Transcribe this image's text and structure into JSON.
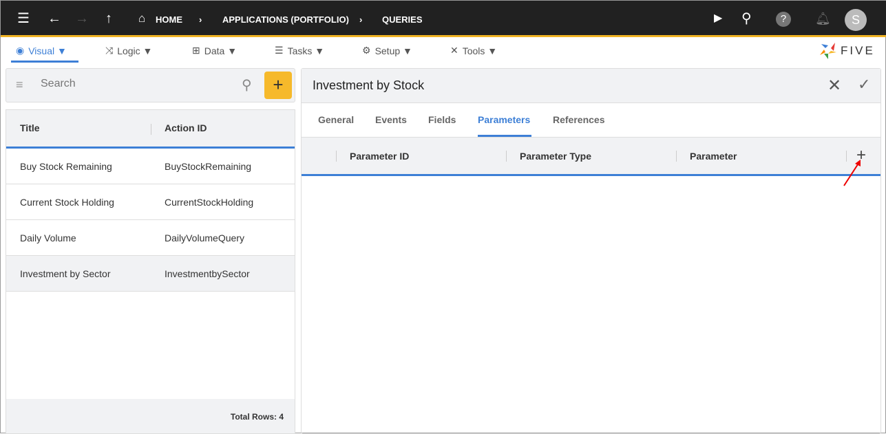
{
  "topbar": {
    "breadcrumbs": [
      "HOME",
      "APPLICATIONS (PORTFOLIO)",
      "QUERIES"
    ],
    "avatar": "S"
  },
  "menu": [
    {
      "label": "Visual ▼"
    },
    {
      "label": "Logic ▼"
    },
    {
      "label": "Data ▼"
    },
    {
      "label": "Tasks ▼"
    },
    {
      "label": "Setup ▼"
    },
    {
      "label": "Tools ▼"
    }
  ],
  "logo": "FIVE",
  "search": {
    "placeholder": "Search"
  },
  "list": {
    "columns": [
      "Title",
      "Action ID"
    ],
    "rows": [
      [
        "Buy Stock Remaining",
        "BuyStockRemaining"
      ],
      [
        "Current Stock Holding",
        "CurrentStockHolding"
      ],
      [
        "Daily Volume",
        "DailyVolumeQuery"
      ],
      [
        "Investment by Sector",
        "InvestmentbySector"
      ]
    ],
    "footer": "Total Rows: 4"
  },
  "detail": {
    "title": "Investment by Stock",
    "tabs": [
      "General",
      "Events",
      "Fields",
      "Parameters",
      "References"
    ],
    "active_tab": "Parameters",
    "columns": [
      "Parameter ID",
      "Parameter Type",
      "Parameter"
    ]
  },
  "colors": {
    "accent": "#3d7fd6",
    "add": "#f6b92b",
    "topbar": "#212121"
  }
}
